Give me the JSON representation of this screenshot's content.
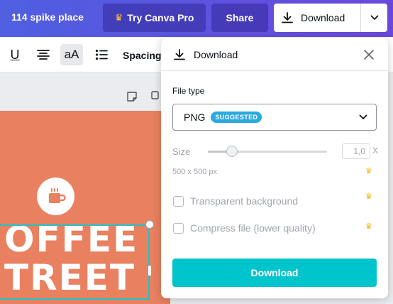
{
  "header": {
    "doc_title": "114 spike place",
    "pro_button": {
      "icon": "crown-icon",
      "label": "Try Canva Pro"
    },
    "share_label": "Share",
    "download_label": "Download",
    "colors": {
      "bar_start": "#4f5fe0",
      "bar_end": "#6a48db",
      "crown": "#ffc233"
    }
  },
  "toolbar": {
    "underline_label": "U",
    "case_label": "aA",
    "spacing_label": "Spacing",
    "icons": [
      "underline-icon",
      "align-icon",
      "text-case-icon",
      "list-icon"
    ]
  },
  "canvas": {
    "background": "#e9805f",
    "lines": [
      "OFFEE",
      "TREET"
    ],
    "icon": "coffee-cup-icon",
    "page_icons": [
      "note-icon",
      "duplicate-icon"
    ]
  },
  "download_panel": {
    "title": "Download",
    "file_type_label": "File type",
    "file_type_value": "PNG",
    "file_type_badge": "SUGGESTED",
    "size_label": "Size",
    "size_value": "1,0",
    "size_suffix": "X",
    "size_slider_fraction": 0.2,
    "dimensions": "500 x 500 px",
    "options": [
      {
        "label": "Transparent background",
        "checked": false,
        "pro": true
      },
      {
        "label": "Compress file (lower quality)",
        "checked": false,
        "pro": true
      }
    ],
    "download_button": "Download",
    "colors": {
      "accent": "#00c4cc",
      "badge": "#2ba9e0",
      "crown": "#f5b400"
    }
  }
}
